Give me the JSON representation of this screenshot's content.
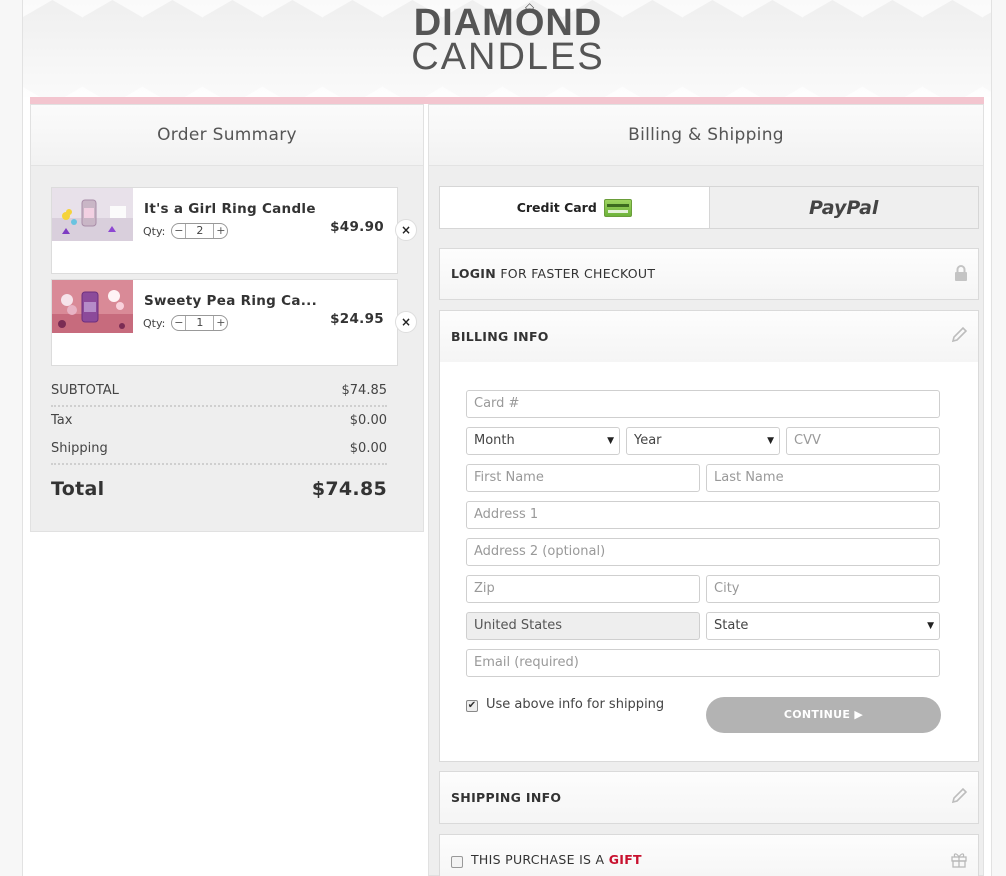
{
  "brand": {
    "line1": "DIAMOND",
    "line2": "CANDLES"
  },
  "order_summary": {
    "title": "Order Summary",
    "items": [
      {
        "name": "It's a Girl Ring Candle",
        "qty_label": "Qty:",
        "qty": "2",
        "price": "$49.90"
      },
      {
        "name": "Sweety Pea Ring Ca...",
        "qty_label": "Qty:",
        "qty": "1",
        "price": "$24.95"
      }
    ],
    "remove_icon": "×",
    "minus": "−",
    "plus": "+",
    "subtotal_label": "SUBTOTAL",
    "subtotal": "$74.85",
    "tax_label": "Tax",
    "tax": "$0.00",
    "shipping_label": "Shipping",
    "shipping": "$0.00",
    "total_label": "Total",
    "total": "$74.85"
  },
  "billing_shipping": {
    "title": "Billing & Shipping",
    "tabs": {
      "credit_card": "Credit Card",
      "paypal": "PayPal"
    },
    "login": {
      "bold": "LOGIN",
      "rest": "FOR FASTER CHECKOUT",
      "icon": "lock-icon"
    },
    "billing_info_title": "BILLING INFO",
    "form": {
      "card_placeholder": "Card #",
      "month": "Month",
      "year": "Year",
      "cvv_placeholder": "CVV",
      "first_name_placeholder": "First Name",
      "last_name_placeholder": "Last Name",
      "address1_placeholder": "Address 1",
      "address2_placeholder": "Address 2 (optional)",
      "zip_placeholder": "Zip",
      "city_placeholder": "City",
      "country": "United States",
      "state": "State",
      "email_placeholder": "Email (required)",
      "use_for_shipping_label": "Use above info for shipping",
      "use_for_shipping_checked": true,
      "continue_label": "CONTINUE ▶"
    },
    "shipping_info_title": "SHIPPING INFO",
    "gift": {
      "prefix": "THIS PURCHASE IS A",
      "word": "GIFT"
    }
  },
  "colors": {
    "accent_pink": "#f3c5cf",
    "gift_red": "#c8102e",
    "continue_grey": "#b3b3b3"
  }
}
